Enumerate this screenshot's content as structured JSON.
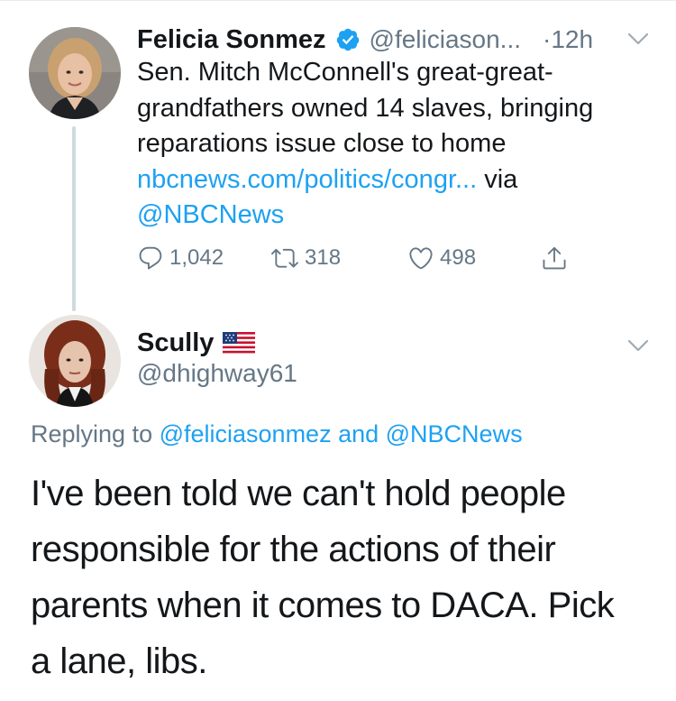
{
  "tweet": {
    "author_name": "Felicia Sonmez",
    "author_handle": "@feliciason...",
    "time_dot": "·",
    "time": "12h",
    "text_line1": "Sen. Mitch McConnell's great-great-",
    "text_line2": "grandfathers owned 14 slaves, bringing",
    "text_line3": "reparations issue close to home",
    "link": "nbcnews.com/politics/congr...",
    "via": " via",
    "via_handle": "@NBCNews",
    "reply_count": "1,042",
    "retweet_count": "318",
    "like_count": "498"
  },
  "reply": {
    "author_name": "Scully",
    "author_handle": "@dhighway61",
    "replying_prefix": "Replying to ",
    "replying_mention1": "@feliciasonmez",
    "replying_and": " and ",
    "replying_mention2": "@NBCNews",
    "text_line1": "I've been told we can't hold people",
    "text_line2": "responsible for the actions of their",
    "text_line3": "parents when it comes to DACA. Pick",
    "text_line4": "a lane, libs."
  },
  "colors": {
    "link": "#1da1f2",
    "secondary": "#657786",
    "text": "#14171a",
    "thread_line": "#cfd9de"
  },
  "icons": {
    "verified": "verified-badge-icon",
    "chevron": "chevron-down-icon",
    "reply": "reply-icon",
    "retweet": "retweet-icon",
    "like": "heart-icon",
    "share": "share-icon",
    "flag": "us-flag-icon"
  }
}
